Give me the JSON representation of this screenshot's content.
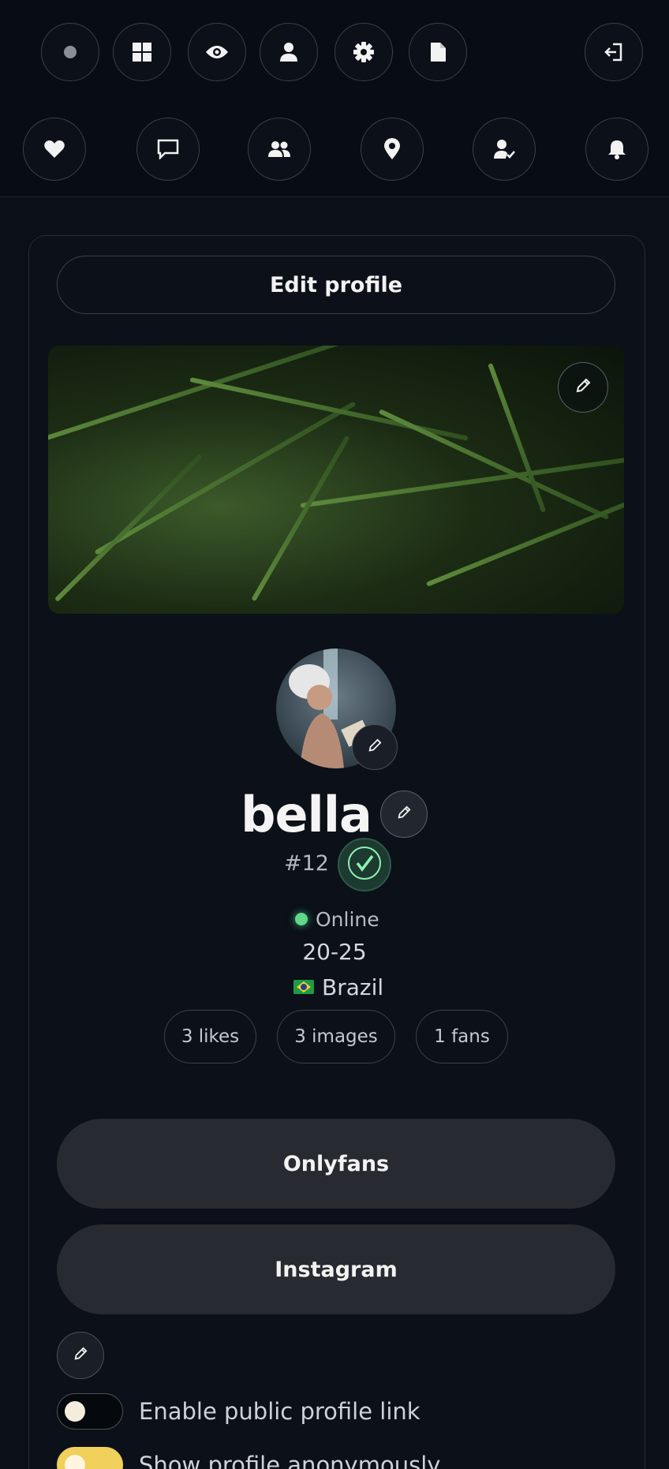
{
  "nav_row1": [
    {
      "icon": "status-dot-icon"
    },
    {
      "icon": "dashboard-grid-icon"
    },
    {
      "icon": "eye-icon"
    },
    {
      "icon": "user-icon"
    },
    {
      "icon": "gear-icon"
    },
    {
      "icon": "document-icon"
    },
    {
      "icon": "logout-icon"
    }
  ],
  "nav_row2": [
    {
      "icon": "heart-icon"
    },
    {
      "icon": "chat-icon"
    },
    {
      "icon": "users-icon"
    },
    {
      "icon": "location-pin-icon"
    },
    {
      "icon": "user-check-icon"
    },
    {
      "icon": "bell-icon"
    }
  ],
  "profile": {
    "edit_profile_label": "Edit profile",
    "name": "bella",
    "id": "#12",
    "status": "Online",
    "age_range": "20-25",
    "country": "Brazil",
    "stats": [
      "3 likes",
      "3 images",
      "1 fans"
    ]
  },
  "links": [
    "Onlyfans",
    "Instagram"
  ],
  "toggles": [
    {
      "label": "Enable public profile link",
      "on": false
    },
    {
      "label": "Show profile anonymously",
      "on": true
    }
  ],
  "colors": {
    "background": "#0b0f16",
    "online": "#5fd88a",
    "verified": "#8ff0b0",
    "toggle_on": "#f0cf5a"
  }
}
